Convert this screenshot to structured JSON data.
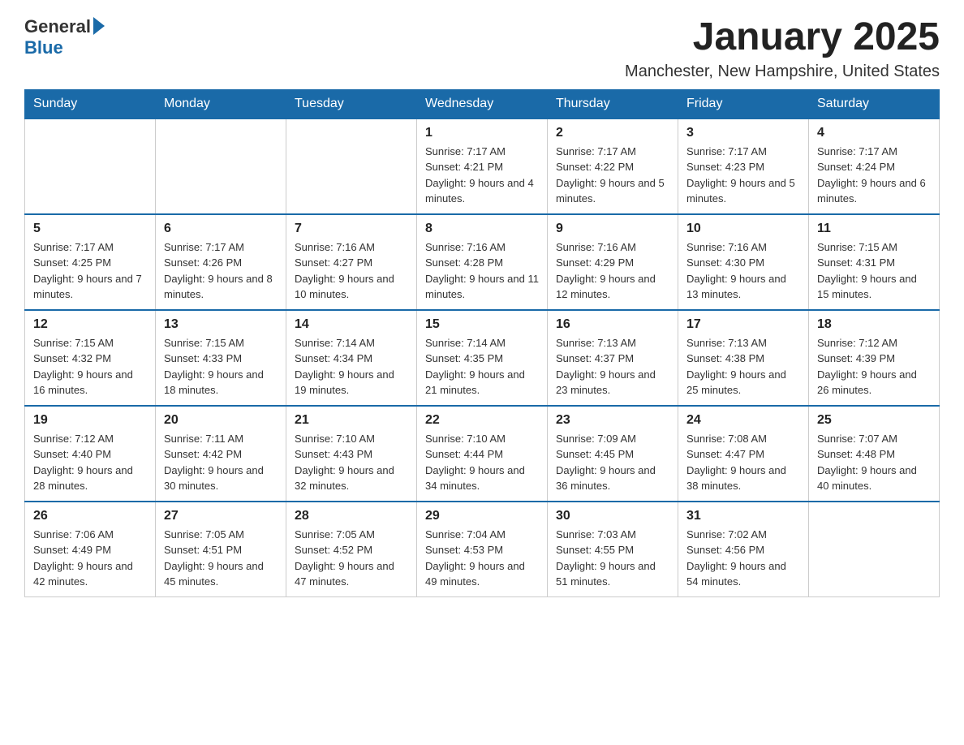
{
  "header": {
    "logo_general": "General",
    "logo_blue": "Blue",
    "month_title": "January 2025",
    "location": "Manchester, New Hampshire, United States"
  },
  "days_of_week": [
    "Sunday",
    "Monday",
    "Tuesday",
    "Wednesday",
    "Thursday",
    "Friday",
    "Saturday"
  ],
  "weeks": [
    [
      {
        "day": "",
        "info": ""
      },
      {
        "day": "",
        "info": ""
      },
      {
        "day": "",
        "info": ""
      },
      {
        "day": "1",
        "info": "Sunrise: 7:17 AM\nSunset: 4:21 PM\nDaylight: 9 hours and 4 minutes."
      },
      {
        "day": "2",
        "info": "Sunrise: 7:17 AM\nSunset: 4:22 PM\nDaylight: 9 hours and 5 minutes."
      },
      {
        "day": "3",
        "info": "Sunrise: 7:17 AM\nSunset: 4:23 PM\nDaylight: 9 hours and 5 minutes."
      },
      {
        "day": "4",
        "info": "Sunrise: 7:17 AM\nSunset: 4:24 PM\nDaylight: 9 hours and 6 minutes."
      }
    ],
    [
      {
        "day": "5",
        "info": "Sunrise: 7:17 AM\nSunset: 4:25 PM\nDaylight: 9 hours and 7 minutes."
      },
      {
        "day": "6",
        "info": "Sunrise: 7:17 AM\nSunset: 4:26 PM\nDaylight: 9 hours and 8 minutes."
      },
      {
        "day": "7",
        "info": "Sunrise: 7:16 AM\nSunset: 4:27 PM\nDaylight: 9 hours and 10 minutes."
      },
      {
        "day": "8",
        "info": "Sunrise: 7:16 AM\nSunset: 4:28 PM\nDaylight: 9 hours and 11 minutes."
      },
      {
        "day": "9",
        "info": "Sunrise: 7:16 AM\nSunset: 4:29 PM\nDaylight: 9 hours and 12 minutes."
      },
      {
        "day": "10",
        "info": "Sunrise: 7:16 AM\nSunset: 4:30 PM\nDaylight: 9 hours and 13 minutes."
      },
      {
        "day": "11",
        "info": "Sunrise: 7:15 AM\nSunset: 4:31 PM\nDaylight: 9 hours and 15 minutes."
      }
    ],
    [
      {
        "day": "12",
        "info": "Sunrise: 7:15 AM\nSunset: 4:32 PM\nDaylight: 9 hours and 16 minutes."
      },
      {
        "day": "13",
        "info": "Sunrise: 7:15 AM\nSunset: 4:33 PM\nDaylight: 9 hours and 18 minutes."
      },
      {
        "day": "14",
        "info": "Sunrise: 7:14 AM\nSunset: 4:34 PM\nDaylight: 9 hours and 19 minutes."
      },
      {
        "day": "15",
        "info": "Sunrise: 7:14 AM\nSunset: 4:35 PM\nDaylight: 9 hours and 21 minutes."
      },
      {
        "day": "16",
        "info": "Sunrise: 7:13 AM\nSunset: 4:37 PM\nDaylight: 9 hours and 23 minutes."
      },
      {
        "day": "17",
        "info": "Sunrise: 7:13 AM\nSunset: 4:38 PM\nDaylight: 9 hours and 25 minutes."
      },
      {
        "day": "18",
        "info": "Sunrise: 7:12 AM\nSunset: 4:39 PM\nDaylight: 9 hours and 26 minutes."
      }
    ],
    [
      {
        "day": "19",
        "info": "Sunrise: 7:12 AM\nSunset: 4:40 PM\nDaylight: 9 hours and 28 minutes."
      },
      {
        "day": "20",
        "info": "Sunrise: 7:11 AM\nSunset: 4:42 PM\nDaylight: 9 hours and 30 minutes."
      },
      {
        "day": "21",
        "info": "Sunrise: 7:10 AM\nSunset: 4:43 PM\nDaylight: 9 hours and 32 minutes."
      },
      {
        "day": "22",
        "info": "Sunrise: 7:10 AM\nSunset: 4:44 PM\nDaylight: 9 hours and 34 minutes."
      },
      {
        "day": "23",
        "info": "Sunrise: 7:09 AM\nSunset: 4:45 PM\nDaylight: 9 hours and 36 minutes."
      },
      {
        "day": "24",
        "info": "Sunrise: 7:08 AM\nSunset: 4:47 PM\nDaylight: 9 hours and 38 minutes."
      },
      {
        "day": "25",
        "info": "Sunrise: 7:07 AM\nSunset: 4:48 PM\nDaylight: 9 hours and 40 minutes."
      }
    ],
    [
      {
        "day": "26",
        "info": "Sunrise: 7:06 AM\nSunset: 4:49 PM\nDaylight: 9 hours and 42 minutes."
      },
      {
        "day": "27",
        "info": "Sunrise: 7:05 AM\nSunset: 4:51 PM\nDaylight: 9 hours and 45 minutes."
      },
      {
        "day": "28",
        "info": "Sunrise: 7:05 AM\nSunset: 4:52 PM\nDaylight: 9 hours and 47 minutes."
      },
      {
        "day": "29",
        "info": "Sunrise: 7:04 AM\nSunset: 4:53 PM\nDaylight: 9 hours and 49 minutes."
      },
      {
        "day": "30",
        "info": "Sunrise: 7:03 AM\nSunset: 4:55 PM\nDaylight: 9 hours and 51 minutes."
      },
      {
        "day": "31",
        "info": "Sunrise: 7:02 AM\nSunset: 4:56 PM\nDaylight: 9 hours and 54 minutes."
      },
      {
        "day": "",
        "info": ""
      }
    ]
  ]
}
